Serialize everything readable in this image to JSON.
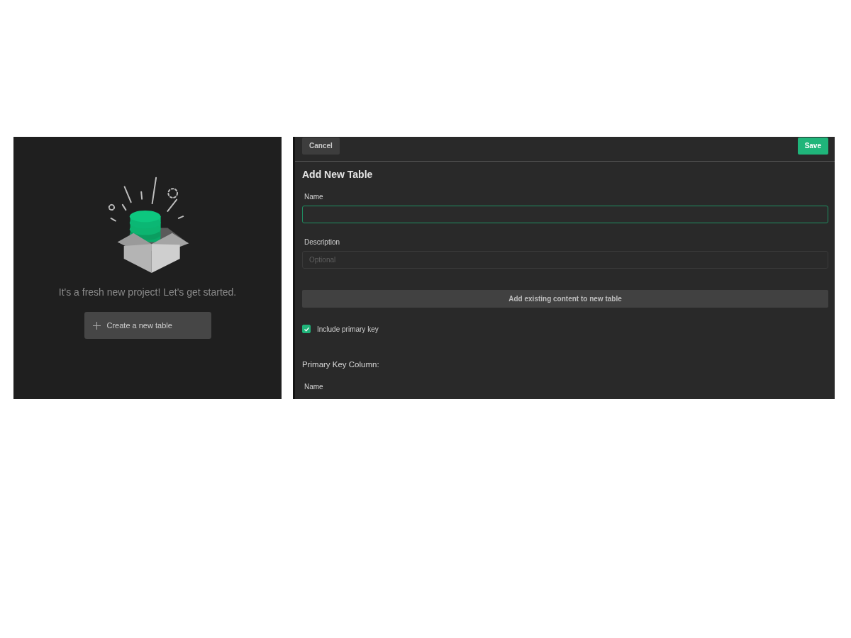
{
  "empty_state": {
    "message": "It's a fresh new project! Let's get started.",
    "button": "Create a new table"
  },
  "form": {
    "cancel": "Cancel",
    "save": "Save",
    "title": "Add New Table",
    "name_field": {
      "label": "Name",
      "focused": true
    },
    "description_field": {
      "label": "Description",
      "placeholder": "Optional"
    },
    "add_existing": "Add existing content to new table",
    "include_primary_key": {
      "label": "Include primary key",
      "checked": true
    },
    "section_title": "Primary Key Column:",
    "column_name_label": "Name"
  }
}
